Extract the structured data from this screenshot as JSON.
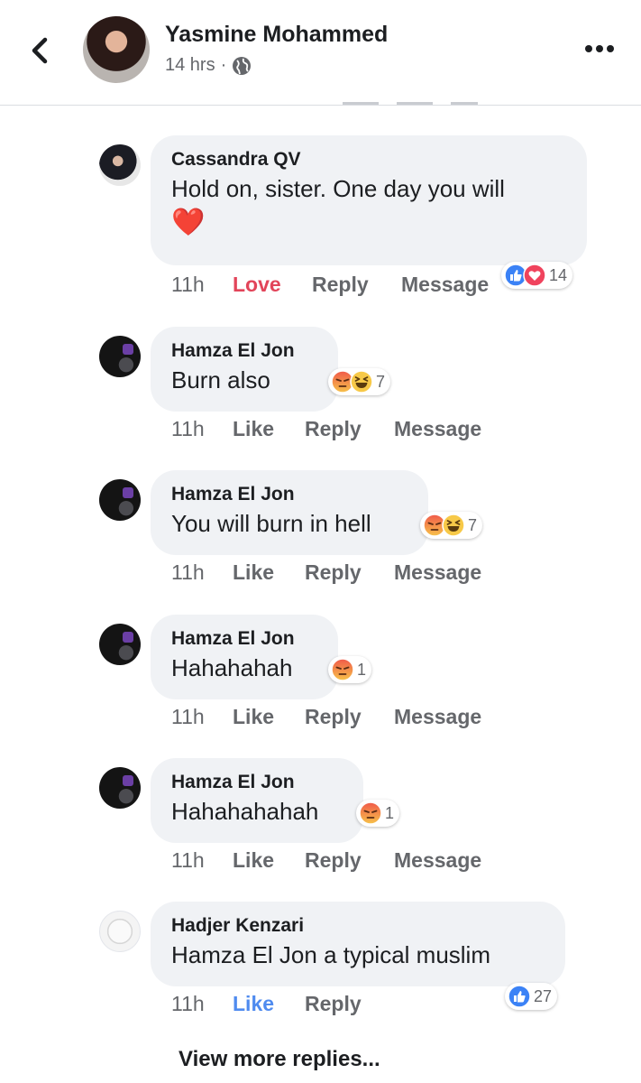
{
  "header": {
    "page_name": "Yasmine Mohammed",
    "time": "14 hrs",
    "separator": "·",
    "privacy_icon": "globe-icon",
    "back_icon": "chevron-left-icon",
    "more_icon": "more-horizontal-icon"
  },
  "comments": [
    {
      "author": "Cassandra QV",
      "text": "Hold on, sister. One day you will",
      "emoji": "❤️",
      "time": "11h",
      "reaction_action": "Love",
      "reply": "Reply",
      "message": "Message",
      "reactions": [
        "like",
        "love"
      ],
      "reaction_count": "14"
    },
    {
      "author": "Hamza El Jon",
      "text": "Burn also",
      "time": "11h",
      "reaction_action": "Like",
      "reply": "Reply",
      "message": "Message",
      "reactions": [
        "angry",
        "haha"
      ],
      "reaction_count": "7"
    },
    {
      "author": "Hamza El Jon",
      "text": "You will burn in hell",
      "time": "11h",
      "reaction_action": "Like",
      "reply": "Reply",
      "message": "Message",
      "reactions": [
        "angry",
        "haha"
      ],
      "reaction_count": "7"
    },
    {
      "author": "Hamza El Jon",
      "text": "Hahahahah",
      "time": "11h",
      "reaction_action": "Like",
      "reply": "Reply",
      "message": "Message",
      "reactions": [
        "angry"
      ],
      "reaction_count": "1"
    },
    {
      "author": "Hamza El Jon",
      "text": "Hahahahahah",
      "time": "11h",
      "reaction_action": "Like",
      "reply": "Reply",
      "message": "Message",
      "reactions": [
        "angry"
      ],
      "reaction_count": "1"
    },
    {
      "author": "Hadjer Kenzari",
      "text": "Hamza El Jon a typical muslim",
      "time": "11h",
      "reaction_action": "Like",
      "reply": "Reply",
      "reactions": [
        "like"
      ],
      "reaction_count": "27"
    }
  ],
  "view_more": "View more replies...",
  "colors": {
    "love": "#e2455a",
    "liked": "#4f8bef",
    "bubble": "#f0f2f5",
    "secondary_text": "#65676b"
  }
}
